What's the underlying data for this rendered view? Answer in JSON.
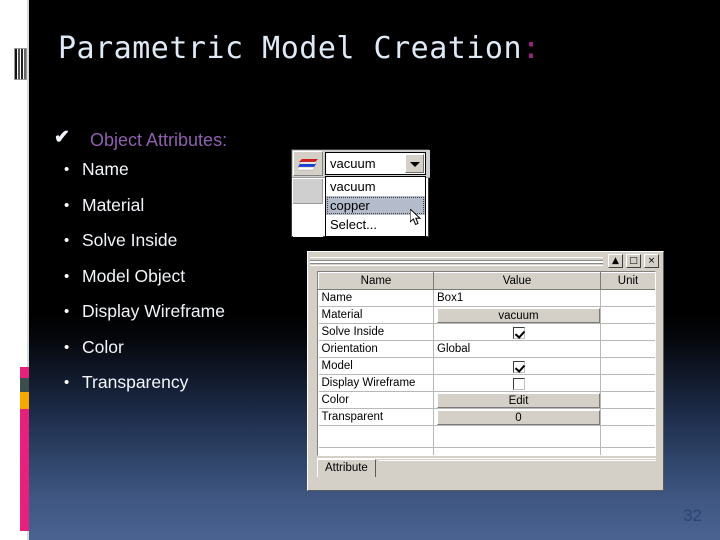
{
  "slide": {
    "title_main": "Parametric Model Creation",
    "title_colon": ":",
    "page_number": "32",
    "accent_purple": "#8e5fae",
    "accent_magenta": "#a3228e",
    "band_pink": "#e5217c",
    "band_orange": "#f5a800",
    "band_dark": "#3b4e4a",
    "bg_top": "#000000",
    "bg_bottom": "#4a6391"
  },
  "outline": {
    "heading": "Object Attributes:",
    "check_glyph": "✔",
    "bullet_glyph": "•",
    "items": [
      "Name",
      "Material",
      "Solve Inside",
      "Model Object",
      "Display Wireframe",
      "Color",
      "Transparency"
    ]
  },
  "material_widget": {
    "icon_name": "material-stack-icon",
    "selected_value": "vacuum",
    "dropdown_arrow": "▼",
    "options": [
      {
        "label": "vacuum",
        "selected": false
      },
      {
        "label": "copper",
        "selected": true
      },
      {
        "label": "Select...",
        "selected": false
      }
    ],
    "cursor": "mouse-pointer"
  },
  "properties_dialog": {
    "window_buttons": [
      {
        "name": "minimize-button",
        "glyph": "▲"
      },
      {
        "name": "maximize-button",
        "glyph": "□"
      },
      {
        "name": "close-button",
        "glyph": "×"
      }
    ],
    "columns": [
      "Name",
      "Value",
      "Unit"
    ],
    "rows": [
      {
        "name": "Name",
        "value": "Box1",
        "kind": "text",
        "unit": ""
      },
      {
        "name": "Material",
        "value": "vacuum",
        "kind": "button",
        "unit": ""
      },
      {
        "name": "Solve Inside",
        "value": "",
        "kind": "checked",
        "unit": ""
      },
      {
        "name": "Orientation",
        "value": "Global",
        "kind": "text",
        "unit": ""
      },
      {
        "name": "Model",
        "value": "",
        "kind": "checked",
        "unit": ""
      },
      {
        "name": "Display Wireframe",
        "value": "",
        "kind": "unchecked",
        "unit": ""
      },
      {
        "name": "Color",
        "value": "Edit",
        "kind": "button",
        "unit": ""
      },
      {
        "name": "Transparent",
        "value": "0",
        "kind": "button",
        "unit": ""
      }
    ],
    "tab_label": "Attribute"
  }
}
